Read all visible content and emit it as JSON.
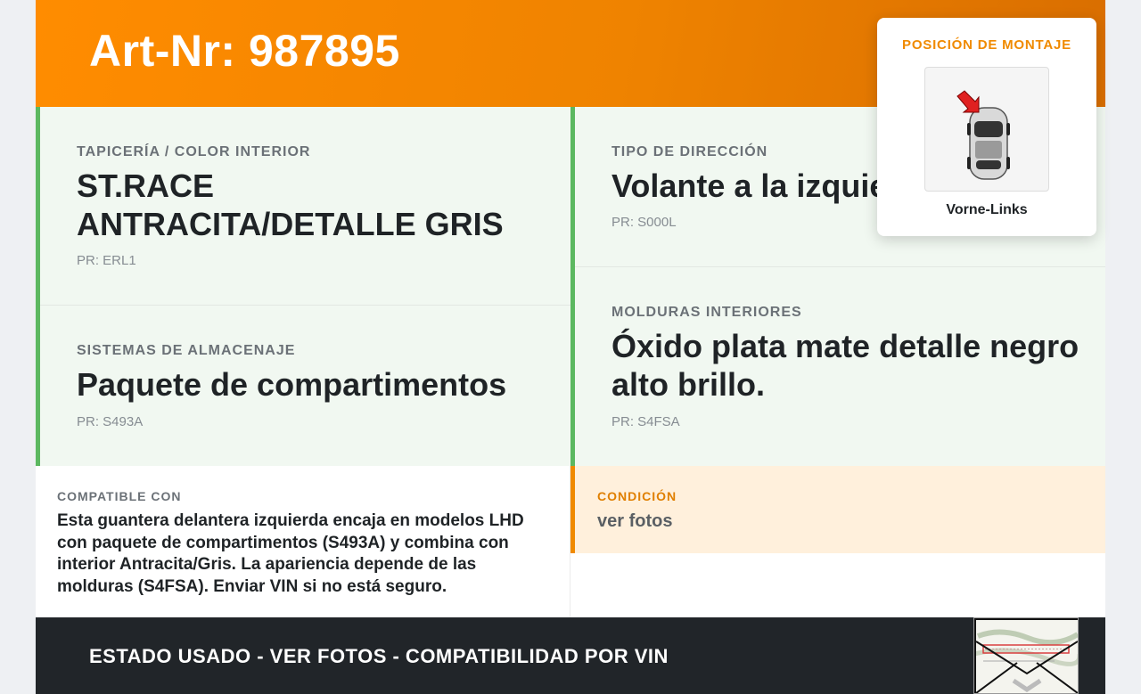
{
  "header": {
    "title": "Art-Nr: 987895"
  },
  "specs": {
    "upholstery": {
      "label": "TAPICERÍA / COLOR INTERIOR",
      "value": "ST.RACE ANTRACITA/DETALLE GRIS",
      "pr": "PR: ERL1"
    },
    "steering": {
      "label": "TIPO DE DIRECCIÓN",
      "value": "Volante a la izquierda",
      "pr": "PR: S000L"
    },
    "storage": {
      "label": "SISTEMAS DE ALMACENAJE",
      "value": "Paquete de compartimentos",
      "pr": "PR: S493A"
    },
    "trim": {
      "label": "MOLDURAS INTERIORES",
      "value": "Óxido plata mate detalle negro alto brillo.",
      "pr": "PR: S4FSA"
    }
  },
  "compat": {
    "label": "COMPATIBLE CON",
    "text": "Esta guantera delantera izquierda encaja en modelos LHD con paquete de compartimentos (S493A) y combina con interior Antracita/Gris. La apariencia depende de las molduras (S4FSA). Enviar VIN si no está seguro."
  },
  "condition": {
    "label": "CONDICIÓN",
    "value": "ver fotos"
  },
  "footer": {
    "text": "ESTADO USADO - VER FOTOS - COMPATIBILIDAD POR VIN"
  },
  "popup": {
    "title": "POSICIÓN DE MONTAJE",
    "caption": "Vorne-Links",
    "icon": "car-top-view-front-left-arrow"
  },
  "colors": {
    "accent": "#f08a00",
    "green": "#5cb860",
    "dark": "#212529"
  }
}
